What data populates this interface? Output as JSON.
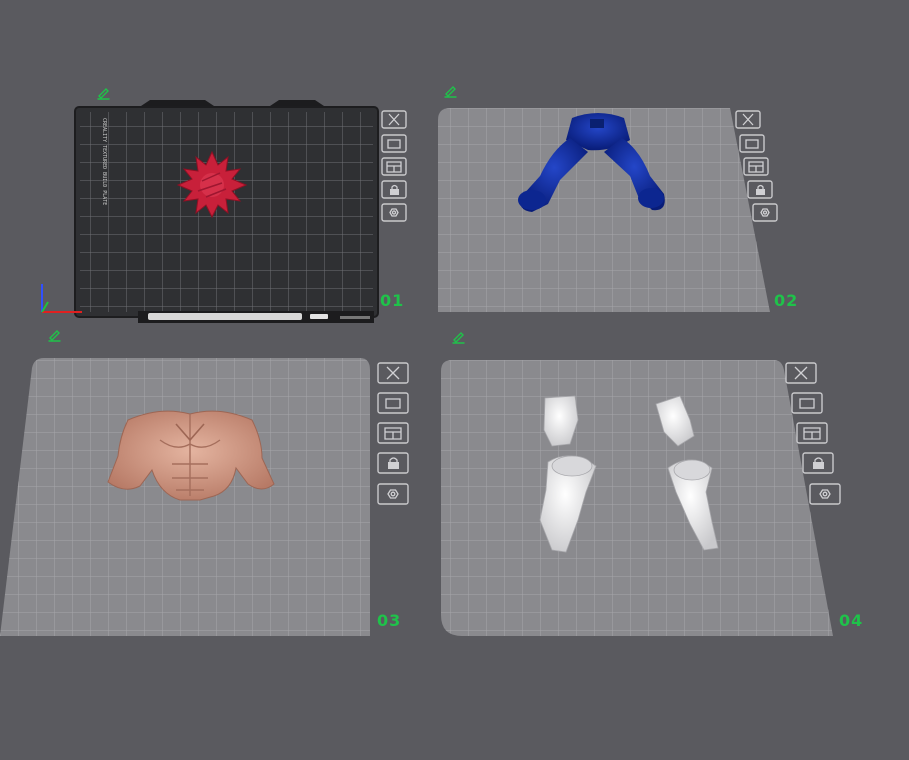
{
  "app": {
    "view": "multi-plate-preview"
  },
  "plates": [
    {
      "id": "01",
      "label": "01",
      "selected": true,
      "model": "red-spiky-head",
      "model_color": "#c8203a",
      "brand_text": "CREALITY TEXTURED BUILD PLATE"
    },
    {
      "id": "02",
      "label": "02",
      "selected": false,
      "model": "blue-legs",
      "model_color": "#0b2a9e"
    },
    {
      "id": "03",
      "label": "03",
      "selected": false,
      "model": "muscular-torso",
      "model_color": "#d59a86"
    },
    {
      "id": "04",
      "label": "04",
      "selected": false,
      "model": "white-arm-parts",
      "model_color": "#e8e8e8"
    }
  ],
  "plate_tools": [
    {
      "name": "close",
      "icon": "close-icon"
    },
    {
      "name": "arrange",
      "icon": "auto-arrange-icon"
    },
    {
      "name": "plate-settings",
      "icon": "plate-settings-icon"
    },
    {
      "name": "lock",
      "icon": "lock-icon"
    },
    {
      "name": "orient",
      "icon": "hexagon-nut-icon"
    }
  ],
  "colors": {
    "background": "#5a5a5f",
    "plate_active": "#2f3033",
    "plate_inactive": "#8a8a8e",
    "label": "#1fc24a"
  }
}
